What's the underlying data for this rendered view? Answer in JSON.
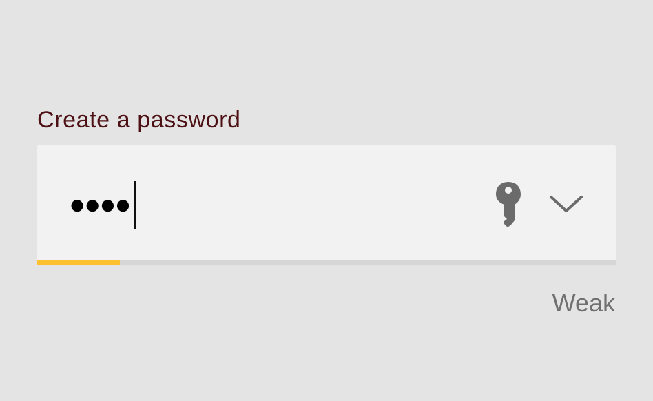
{
  "form": {
    "label": "Create a password",
    "password_mask": "●●●●",
    "strength": {
      "label": "Weak",
      "fraction": 0.143,
      "color": "#fdc02f",
      "track_color": "#d6d6d6"
    }
  },
  "icons": {
    "key": "key-icon",
    "dropdown": "chevron-down-icon"
  },
  "colors": {
    "background": "#e4e4e4",
    "field_background": "#f2f2f2",
    "label": "#4d1014",
    "icon": "#6b6b6b",
    "strength_text": "#707070"
  }
}
